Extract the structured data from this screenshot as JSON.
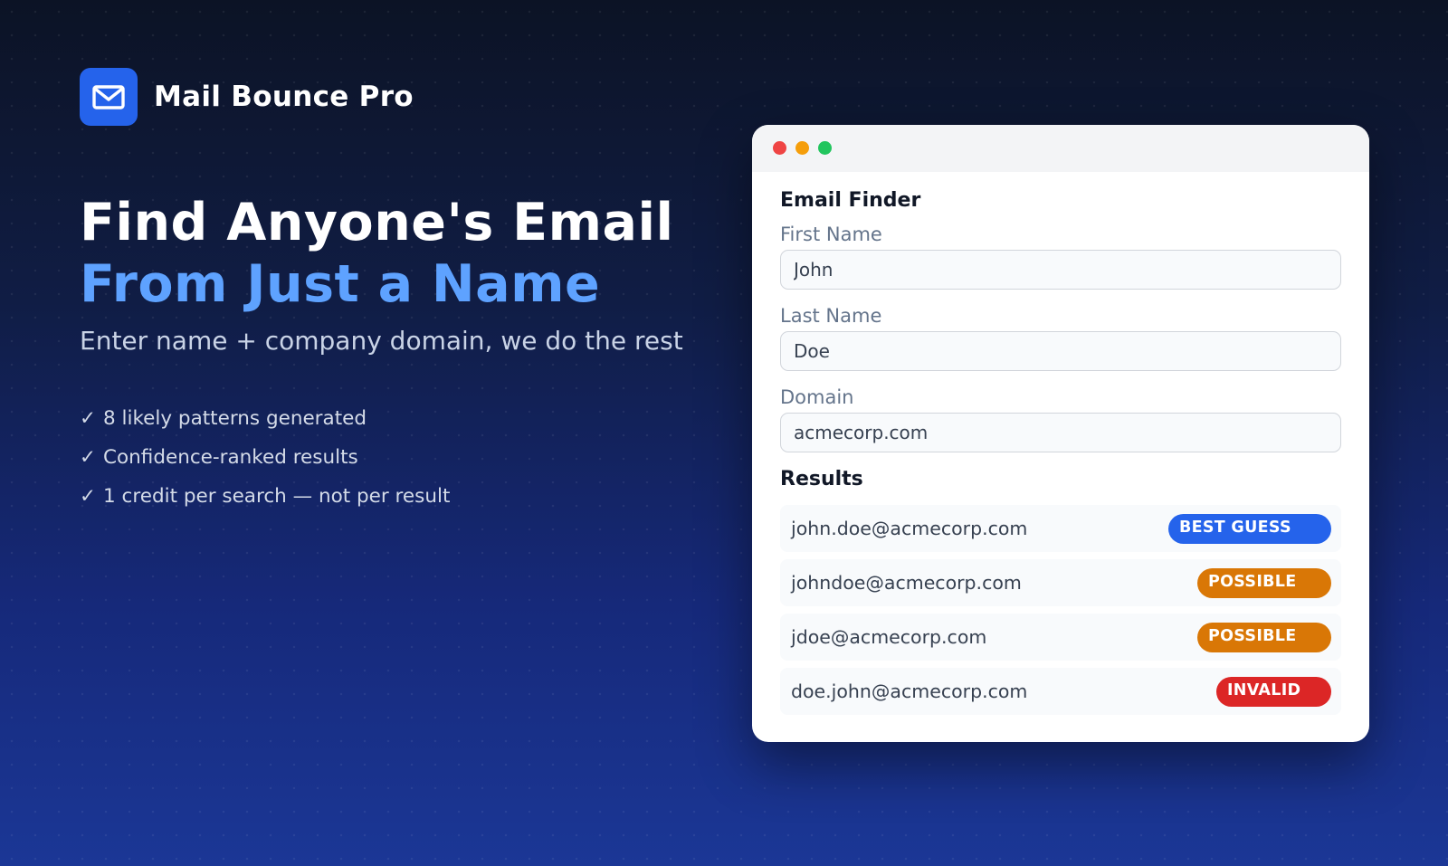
{
  "brand": {
    "icon": "mail-icon",
    "name": "Mail Bounce Pro",
    "logo_color": "#2563eb"
  },
  "hero": {
    "headline_line1": "Find Anyone's Email",
    "headline_line2": "From Just a Name",
    "subtitle": "Enter name + company domain, we do the rest",
    "features": [
      "8 likely patterns generated",
      "Confidence-ranked results",
      "1 credit per search — not per result"
    ],
    "check_symbol": "✓"
  },
  "finder": {
    "title": "Email Finder",
    "fields": [
      {
        "label": "First Name",
        "value": "John"
      },
      {
        "label": "Last Name",
        "value": "Doe"
      },
      {
        "label": "Domain",
        "value": "acmecorp.com"
      }
    ],
    "results_title": "Results",
    "results": [
      {
        "email": "john.doe@acmecorp.com",
        "badge": "BEST GUESS",
        "badge_color": "#2563eb"
      },
      {
        "email": "johndoe@acmecorp.com",
        "badge": "POSSIBLE",
        "badge_color": "#d97706"
      },
      {
        "email": "jdoe@acmecorp.com",
        "badge": "POSSIBLE",
        "badge_color": "#d97706"
      },
      {
        "email": "doe.john@acmecorp.com",
        "badge": "INVALID",
        "badge_color": "#dc2626"
      }
    ]
  },
  "colors": {
    "accent_blue": "#5ea2ff",
    "background_top": "#0c1325",
    "background_bottom": "#1b3796"
  }
}
